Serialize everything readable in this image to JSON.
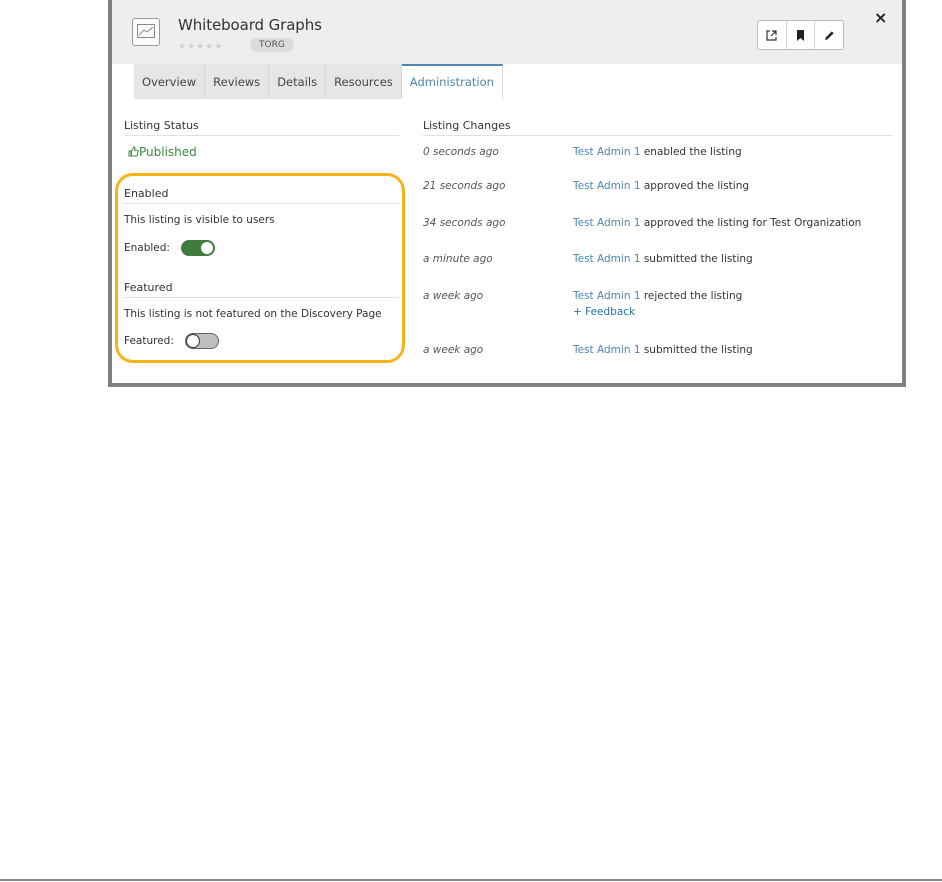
{
  "listing": {
    "title": "Whiteboard Graphs",
    "stars": "★★★★★",
    "org": "TORG",
    "close_glyph": "×"
  },
  "toolbar": {
    "buttons": [
      {
        "icon": "external-link-icon"
      },
      {
        "icon": "bookmark-icon"
      },
      {
        "icon": "pencil-icon"
      }
    ]
  },
  "tabs": [
    {
      "label": "Overview"
    },
    {
      "label": "Reviews"
    },
    {
      "label": "Details"
    },
    {
      "label": "Resources"
    },
    {
      "label": "Administration",
      "active": true
    }
  ],
  "status": {
    "heading": "Listing Status",
    "value": "Published",
    "value_icon": "thumbs-up-icon"
  },
  "enabled": {
    "heading": "Enabled",
    "description": "This listing is visible to users",
    "label": "Enabled:",
    "on": true
  },
  "featured": {
    "heading": "Featured",
    "description": "This listing is not featured on the Discovery Page",
    "label": "Featured:",
    "on": false
  },
  "changes": {
    "heading": "Listing Changes",
    "items": [
      {
        "when": "0 seconds ago",
        "who": "Test Admin 1",
        "action": " enabled the listing"
      },
      {
        "when": "21 seconds ago",
        "who": "Test Admin 1",
        "action": " approved the listing"
      },
      {
        "when": "34 seconds ago",
        "who": "Test Admin 1",
        "action": " approved the listing for Test Organization"
      },
      {
        "when": "a minute ago",
        "who": "Test Admin 1",
        "action": " submitted the listing"
      },
      {
        "when": "a week ago",
        "who": "Test Admin 1",
        "action": " rejected the listing",
        "feedback": "+ Feedback"
      },
      {
        "when": "a week ago",
        "who": "Test Admin 1",
        "action": " submitted the listing"
      }
    ]
  },
  "colors": {
    "accent": "#4e86b4",
    "published": "#3c8a3c",
    "highlight": "#f5b31a",
    "toggle_on": "#3f7d3f"
  }
}
